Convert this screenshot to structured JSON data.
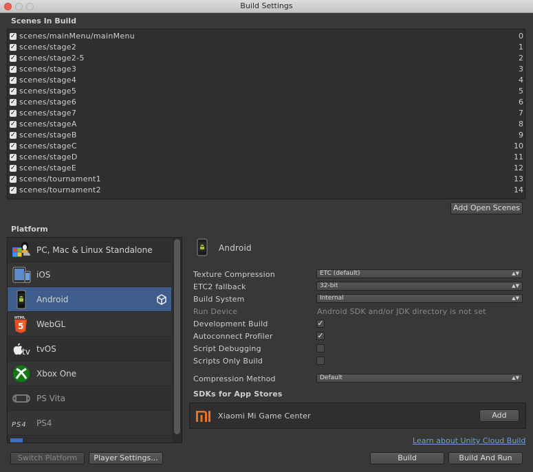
{
  "window": {
    "title": "Build Settings"
  },
  "scenes": {
    "header": "Scenes In Build",
    "items": [
      {
        "name": "scenes/mainMenu/mainMenu",
        "index": "0",
        "checked": true
      },
      {
        "name": "scenes/stage2",
        "index": "1",
        "checked": true
      },
      {
        "name": "scenes/stage2-5",
        "index": "2",
        "checked": true
      },
      {
        "name": "scenes/stage3",
        "index": "3",
        "checked": true
      },
      {
        "name": "scenes/stage4",
        "index": "4",
        "checked": true
      },
      {
        "name": "scenes/stage5",
        "index": "5",
        "checked": true
      },
      {
        "name": "scenes/stage6",
        "index": "6",
        "checked": true
      },
      {
        "name": "scenes/stage7",
        "index": "7",
        "checked": true
      },
      {
        "name": "scenes/stageA",
        "index": "8",
        "checked": true
      },
      {
        "name": "scenes/stageB",
        "index": "9",
        "checked": true
      },
      {
        "name": "scenes/stageC",
        "index": "10",
        "checked": true
      },
      {
        "name": "scenes/stageD",
        "index": "11",
        "checked": true
      },
      {
        "name": "scenes/stageE",
        "index": "12",
        "checked": true
      },
      {
        "name": "scenes/tournament1",
        "index": "13",
        "checked": true
      },
      {
        "name": "scenes/tournament2",
        "index": "14",
        "checked": true
      }
    ],
    "add_open_scenes": "Add Open Scenes"
  },
  "platform": {
    "header": "Platform",
    "items": [
      {
        "name": "PC, Mac & Linux Standalone",
        "icon": "standalone-icon"
      },
      {
        "name": "iOS",
        "icon": "ios-icon"
      },
      {
        "name": "Android",
        "icon": "android-icon",
        "selected": true
      },
      {
        "name": "WebGL",
        "icon": "html5-icon"
      },
      {
        "name": "tvOS",
        "icon": "appletv-icon"
      },
      {
        "name": "Xbox One",
        "icon": "xbox-icon"
      },
      {
        "name": "PS Vita",
        "icon": "psvita-icon"
      },
      {
        "name": "PS4",
        "icon": "ps4-icon"
      }
    ],
    "switch_platform": "Switch Platform",
    "player_settings": "Player Settings..."
  },
  "settings": {
    "platform_title": "Android",
    "texture_compression": {
      "label": "Texture Compression",
      "value": "ETC (default)"
    },
    "etc2_fallback": {
      "label": "ETC2 fallback",
      "value": "32-bit"
    },
    "build_system": {
      "label": "Build System",
      "value": "Internal"
    },
    "run_device": {
      "label": "Run Device",
      "value": "Android SDK and/or JDK directory is not set"
    },
    "development_build": {
      "label": "Development Build",
      "checked": true
    },
    "autoconnect_profiler": {
      "label": "Autoconnect Profiler",
      "checked": true
    },
    "script_debugging": {
      "label": "Script Debugging",
      "checked": false
    },
    "scripts_only_build": {
      "label": "Scripts Only Build",
      "checked": false
    },
    "compression_method": {
      "label": "Compression Method",
      "value": "Default"
    },
    "sdks_header": "SDKs for App Stores",
    "sdk": {
      "name": "Xiaomi Mi Game Center",
      "add": "Add"
    },
    "cloud_link": "Learn about Unity Cloud Build",
    "build": "Build",
    "build_and_run": "Build And Run"
  },
  "colors": {
    "selected": "#3e5d8d",
    "background": "#383838",
    "link": "#6f9fe6",
    "xiaomi": "#f36f21"
  }
}
